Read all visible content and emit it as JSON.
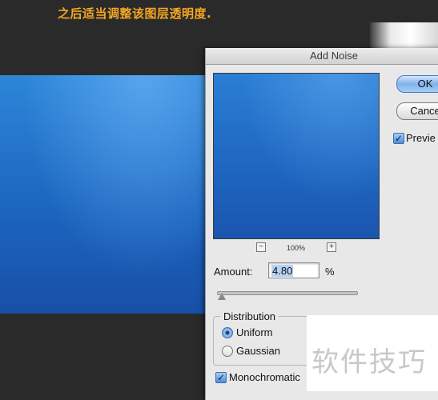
{
  "caption": "之后适当调整该图层透明度.",
  "dialog": {
    "title": "Add Noise",
    "ok_label": "OK",
    "cancel_label": "Cance",
    "preview_label": "Previe",
    "preview_checked": true,
    "zoom_level": "100%",
    "zoom_out_glyph": "−",
    "zoom_in_glyph": "+",
    "amount_label": "Amount:",
    "amount_value": "4.80",
    "amount_unit": "%",
    "distribution": {
      "legend": "Distribution",
      "options": [
        {
          "label": "Uniform",
          "selected": true
        },
        {
          "label": "Gaussian",
          "selected": false
        }
      ]
    },
    "monochromatic_label": "Monochromatic",
    "monochromatic_checked": true
  },
  "watermark": "软件技巧",
  "colors": {
    "caption": "#f5a623",
    "canvas_blue": "#1c66c0",
    "default_button": "#7fb2ec"
  }
}
